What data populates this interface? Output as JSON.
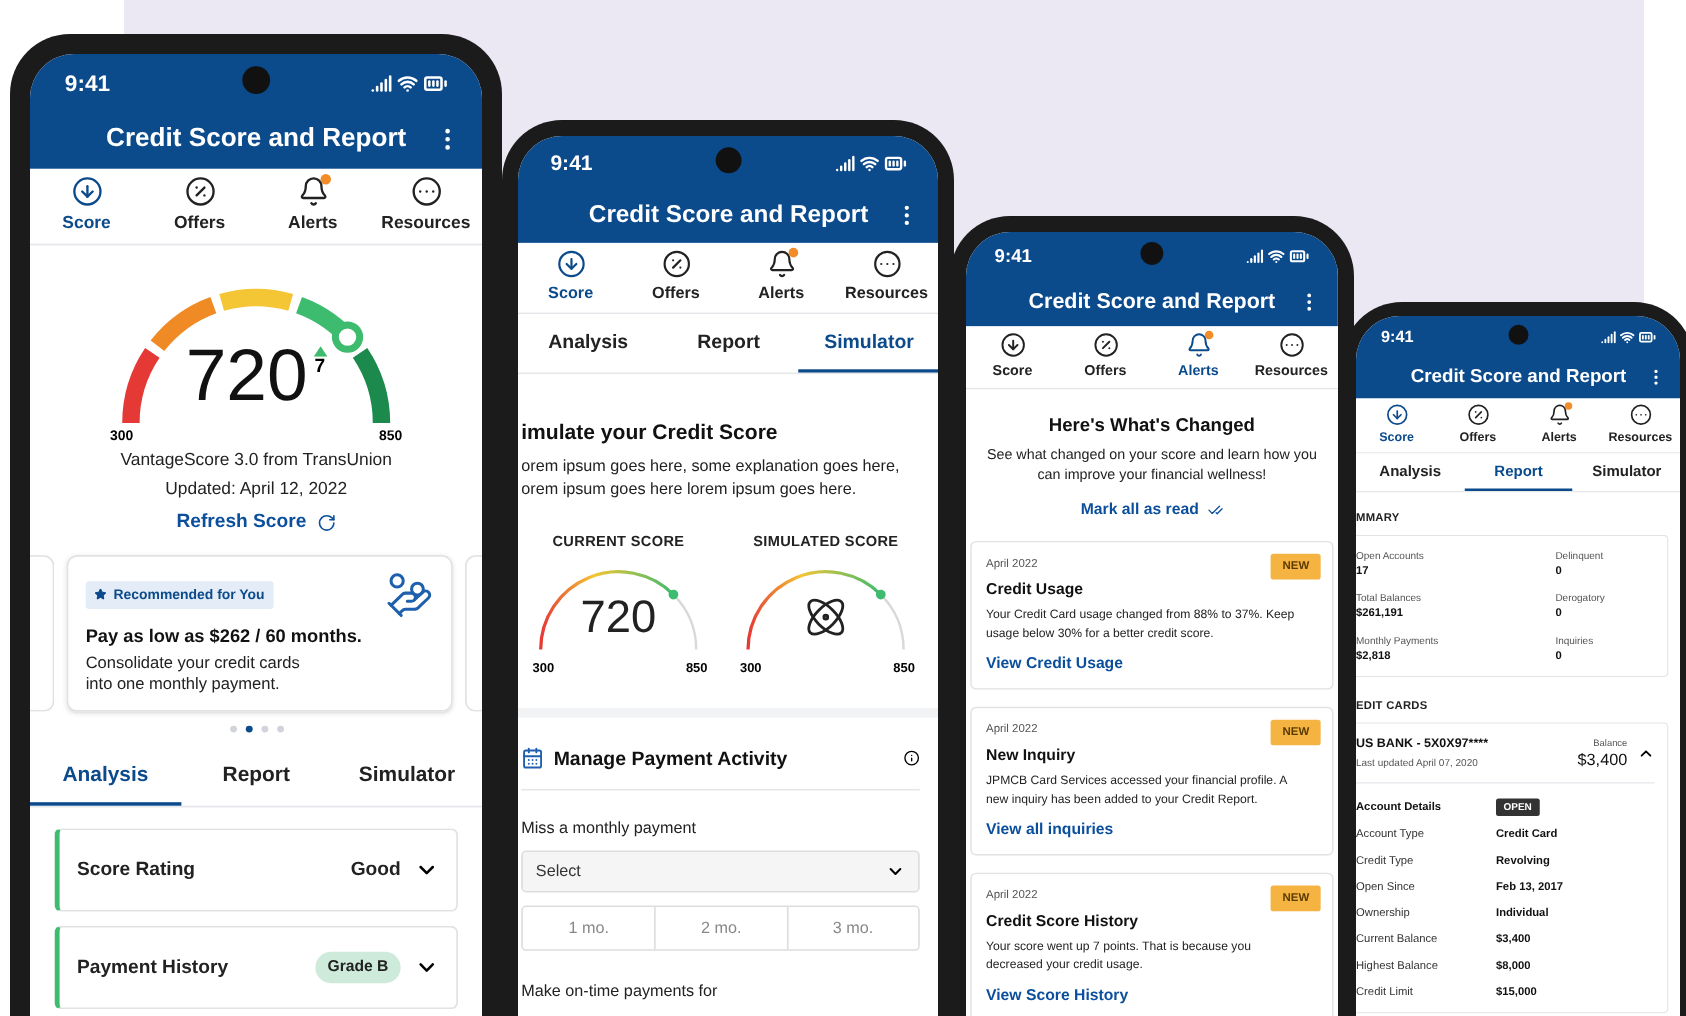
{
  "phones": [
    {
      "kind": "score",
      "time": "9:41",
      "title": "Credit Score and Report",
      "nav": [
        {
          "label": "Score",
          "kind": "score",
          "selected": true,
          "notification": false
        },
        {
          "label": "Offers",
          "kind": "offers",
          "selected": false,
          "notification": false
        },
        {
          "label": "Alerts",
          "kind": "alerts",
          "selected": false,
          "notification": true
        },
        {
          "label": "Resources",
          "kind": "resources",
          "selected": false,
          "notification": false
        }
      ],
      "gauge": {
        "score": "720",
        "change": "7",
        "min": "300",
        "max": "850",
        "level": 0.76
      },
      "source": "VantageScore 3.0 from TransUnion",
      "updated": "Updated: April 12, 2022",
      "refresh": "Refresh Score",
      "promo": {
        "badge": "Recommended for You",
        "headline": "Pay as low as $262 / 60 months.",
        "body": "Consolidate your credit cards into one monthly payment."
      },
      "carousel_dots": [
        {
          "selected": false
        },
        {
          "selected": true
        },
        {
          "selected": false
        },
        {
          "selected": false
        }
      ],
      "tabs": [
        {
          "label": "Analysis",
          "selected": true
        },
        {
          "label": "Report",
          "selected": false
        },
        {
          "label": "Simulator",
          "selected": false
        }
      ],
      "factors": [
        {
          "label": "Score Rating",
          "value": "Good",
          "kind": "text"
        },
        {
          "label": "Payment History",
          "value": "Grade B",
          "kind": "pill"
        }
      ]
    },
    {
      "kind": "simulator",
      "time": "9:41",
      "title": "Credit Score and Report",
      "nav": [
        {
          "label": "Score",
          "kind": "score",
          "selected": true,
          "notification": false
        },
        {
          "label": "Offers",
          "kind": "offers",
          "selected": false,
          "notification": false
        },
        {
          "label": "Alerts",
          "kind": "alerts",
          "selected": false,
          "notification": true
        },
        {
          "label": "Resources",
          "kind": "resources",
          "selected": false,
          "notification": false
        }
      ],
      "tabs": [
        {
          "label": "Analysis",
          "selected": false
        },
        {
          "label": "Report",
          "selected": false
        },
        {
          "label": "Simulator",
          "selected": true
        }
      ],
      "heading": "imulate your Credit Score",
      "intro_lines": [
        "orem ipsum goes here, some explanation goes here,",
        "orem ipsum goes here lorem ipsum goes here."
      ],
      "gauges": [
        {
          "label": "CURRENT SCORE",
          "kind": "number",
          "value": "720",
          "min": "300",
          "max": "850",
          "level": 0.75
        },
        {
          "label": "SIMULATED SCORE",
          "kind": "atom",
          "min": "300",
          "max": "850",
          "level": 0.75
        }
      ],
      "section_title": "Manage Payment Activity",
      "field_label": "Miss a monthly payment",
      "select": {
        "placeholder": "Select"
      },
      "segments": [
        {
          "label": "1 mo.",
          "selected": false
        },
        {
          "label": "2 mo.",
          "selected": false
        },
        {
          "label": "3 mo.",
          "selected": false
        }
      ],
      "footer": "Make on-time payments for"
    },
    {
      "kind": "alerts",
      "time": "9:41",
      "title": "Credit Score and Report",
      "nav": [
        {
          "label": "Score",
          "kind": "score",
          "selected": false,
          "notification": false
        },
        {
          "label": "Offers",
          "kind": "offers",
          "selected": false,
          "notification": false
        },
        {
          "label": "Alerts",
          "kind": "alerts",
          "selected": true,
          "notification": true
        },
        {
          "label": "Resources",
          "kind": "resources",
          "selected": false,
          "notification": false
        }
      ],
      "heading": "Here's What's Changed",
      "description": "See what changed on your score and learn how you can improve your financial wellness!",
      "mark_read": "Mark all as read",
      "alerts": [
        {
          "date": "April 2022",
          "badge": "NEW",
          "title": "Credit Usage",
          "body": "Your Credit Card usage changed from 88% to 37%. Keep usage below 30% for a better credit score.",
          "link": "View Credit Usage"
        },
        {
          "date": "April 2022",
          "badge": "NEW",
          "title": "New Inquiry",
          "body": "JPMCB Card Services accessed your financial profile. A new inquiry has been added to your Credit Report.",
          "link": "View all inquiries"
        },
        {
          "date": "April 2022",
          "badge": "NEW",
          "title": "Credit Score History",
          "body": "Your score went up 7 points. That is because you decreased your credit usage.",
          "link": "View Score History"
        }
      ]
    },
    {
      "kind": "report",
      "time": "9:41",
      "title": "Credit Score and Report",
      "nav": [
        {
          "label": "Score",
          "kind": "score",
          "selected": true,
          "notification": false
        },
        {
          "label": "Offers",
          "kind": "offers",
          "selected": false,
          "notification": false
        },
        {
          "label": "Alerts",
          "kind": "alerts",
          "selected": false,
          "notification": true
        },
        {
          "label": "Resources",
          "kind": "resources",
          "selected": false,
          "notification": false
        }
      ],
      "tabs": [
        {
          "label": "Analysis",
          "selected": false
        },
        {
          "label": "Report",
          "selected": true
        },
        {
          "label": "Simulator",
          "selected": false
        }
      ],
      "summary_label": "MMARY",
      "summary": [
        {
          "label": "Open Accounts",
          "value": "17"
        },
        {
          "label": "Delinquent",
          "value": "0"
        },
        {
          "label": "Total Balances",
          "value": "$261,191"
        },
        {
          "label": "Derogatory",
          "value": "0"
        },
        {
          "label": "Monthly Payments",
          "value": "$2,818"
        },
        {
          "label": "Inquiries",
          "value": "0"
        }
      ],
      "cards_label": "EDIT CARDS",
      "account": {
        "name": "US BANK - 5X0X97****",
        "updated": "Last updated April 07, 2020",
        "balance_label": "Balance",
        "balance": "$3,400",
        "expanded": true,
        "details_label": "Account Details",
        "status": "OPEN",
        "details": [
          {
            "label": "Account Type",
            "value": "Credit Card"
          },
          {
            "label": "Credit Type",
            "value": "Revolving"
          },
          {
            "label": "Open Since",
            "value": "Feb 13, 2017"
          },
          {
            "label": "Ownership",
            "value": "Individual"
          },
          {
            "label": "Current Balance",
            "value": "$3,400"
          },
          {
            "label": "Highest Balance",
            "value": "$8,000"
          },
          {
            "label": "Credit Limit",
            "value": "$15,000"
          }
        ]
      }
    }
  ]
}
